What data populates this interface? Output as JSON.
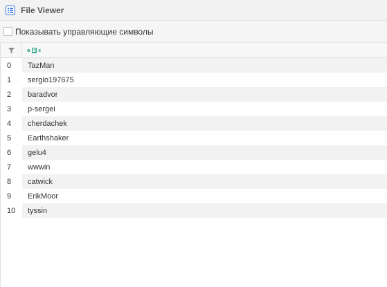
{
  "window": {
    "title": "File Viewer",
    "icon": "list-icon"
  },
  "options": {
    "show_control_chars_label": "Показывать управляющие символы",
    "show_control_chars_checked": false
  },
  "grid": {
    "filter_icon": "filter-icon",
    "column_type_icon": "abc-text-icon",
    "column_type_glyphs": [
      "a",
      "B",
      "c"
    ],
    "rows": [
      {
        "index": "0",
        "value": "TazMan"
      },
      {
        "index": "1",
        "value": "sergio197675"
      },
      {
        "index": "2",
        "value": "baradvor"
      },
      {
        "index": "3",
        "value": "p-sergei"
      },
      {
        "index": "4",
        "value": "cherdachek"
      },
      {
        "index": "5",
        "value": "Earthshaker"
      },
      {
        "index": "6",
        "value": "gelu4"
      },
      {
        "index": "7",
        "value": "wwwin"
      },
      {
        "index": "8",
        "value": "catwick"
      },
      {
        "index": "9",
        "value": "ErikMoor"
      },
      {
        "index": "10",
        "value": "tyssin"
      }
    ]
  }
}
